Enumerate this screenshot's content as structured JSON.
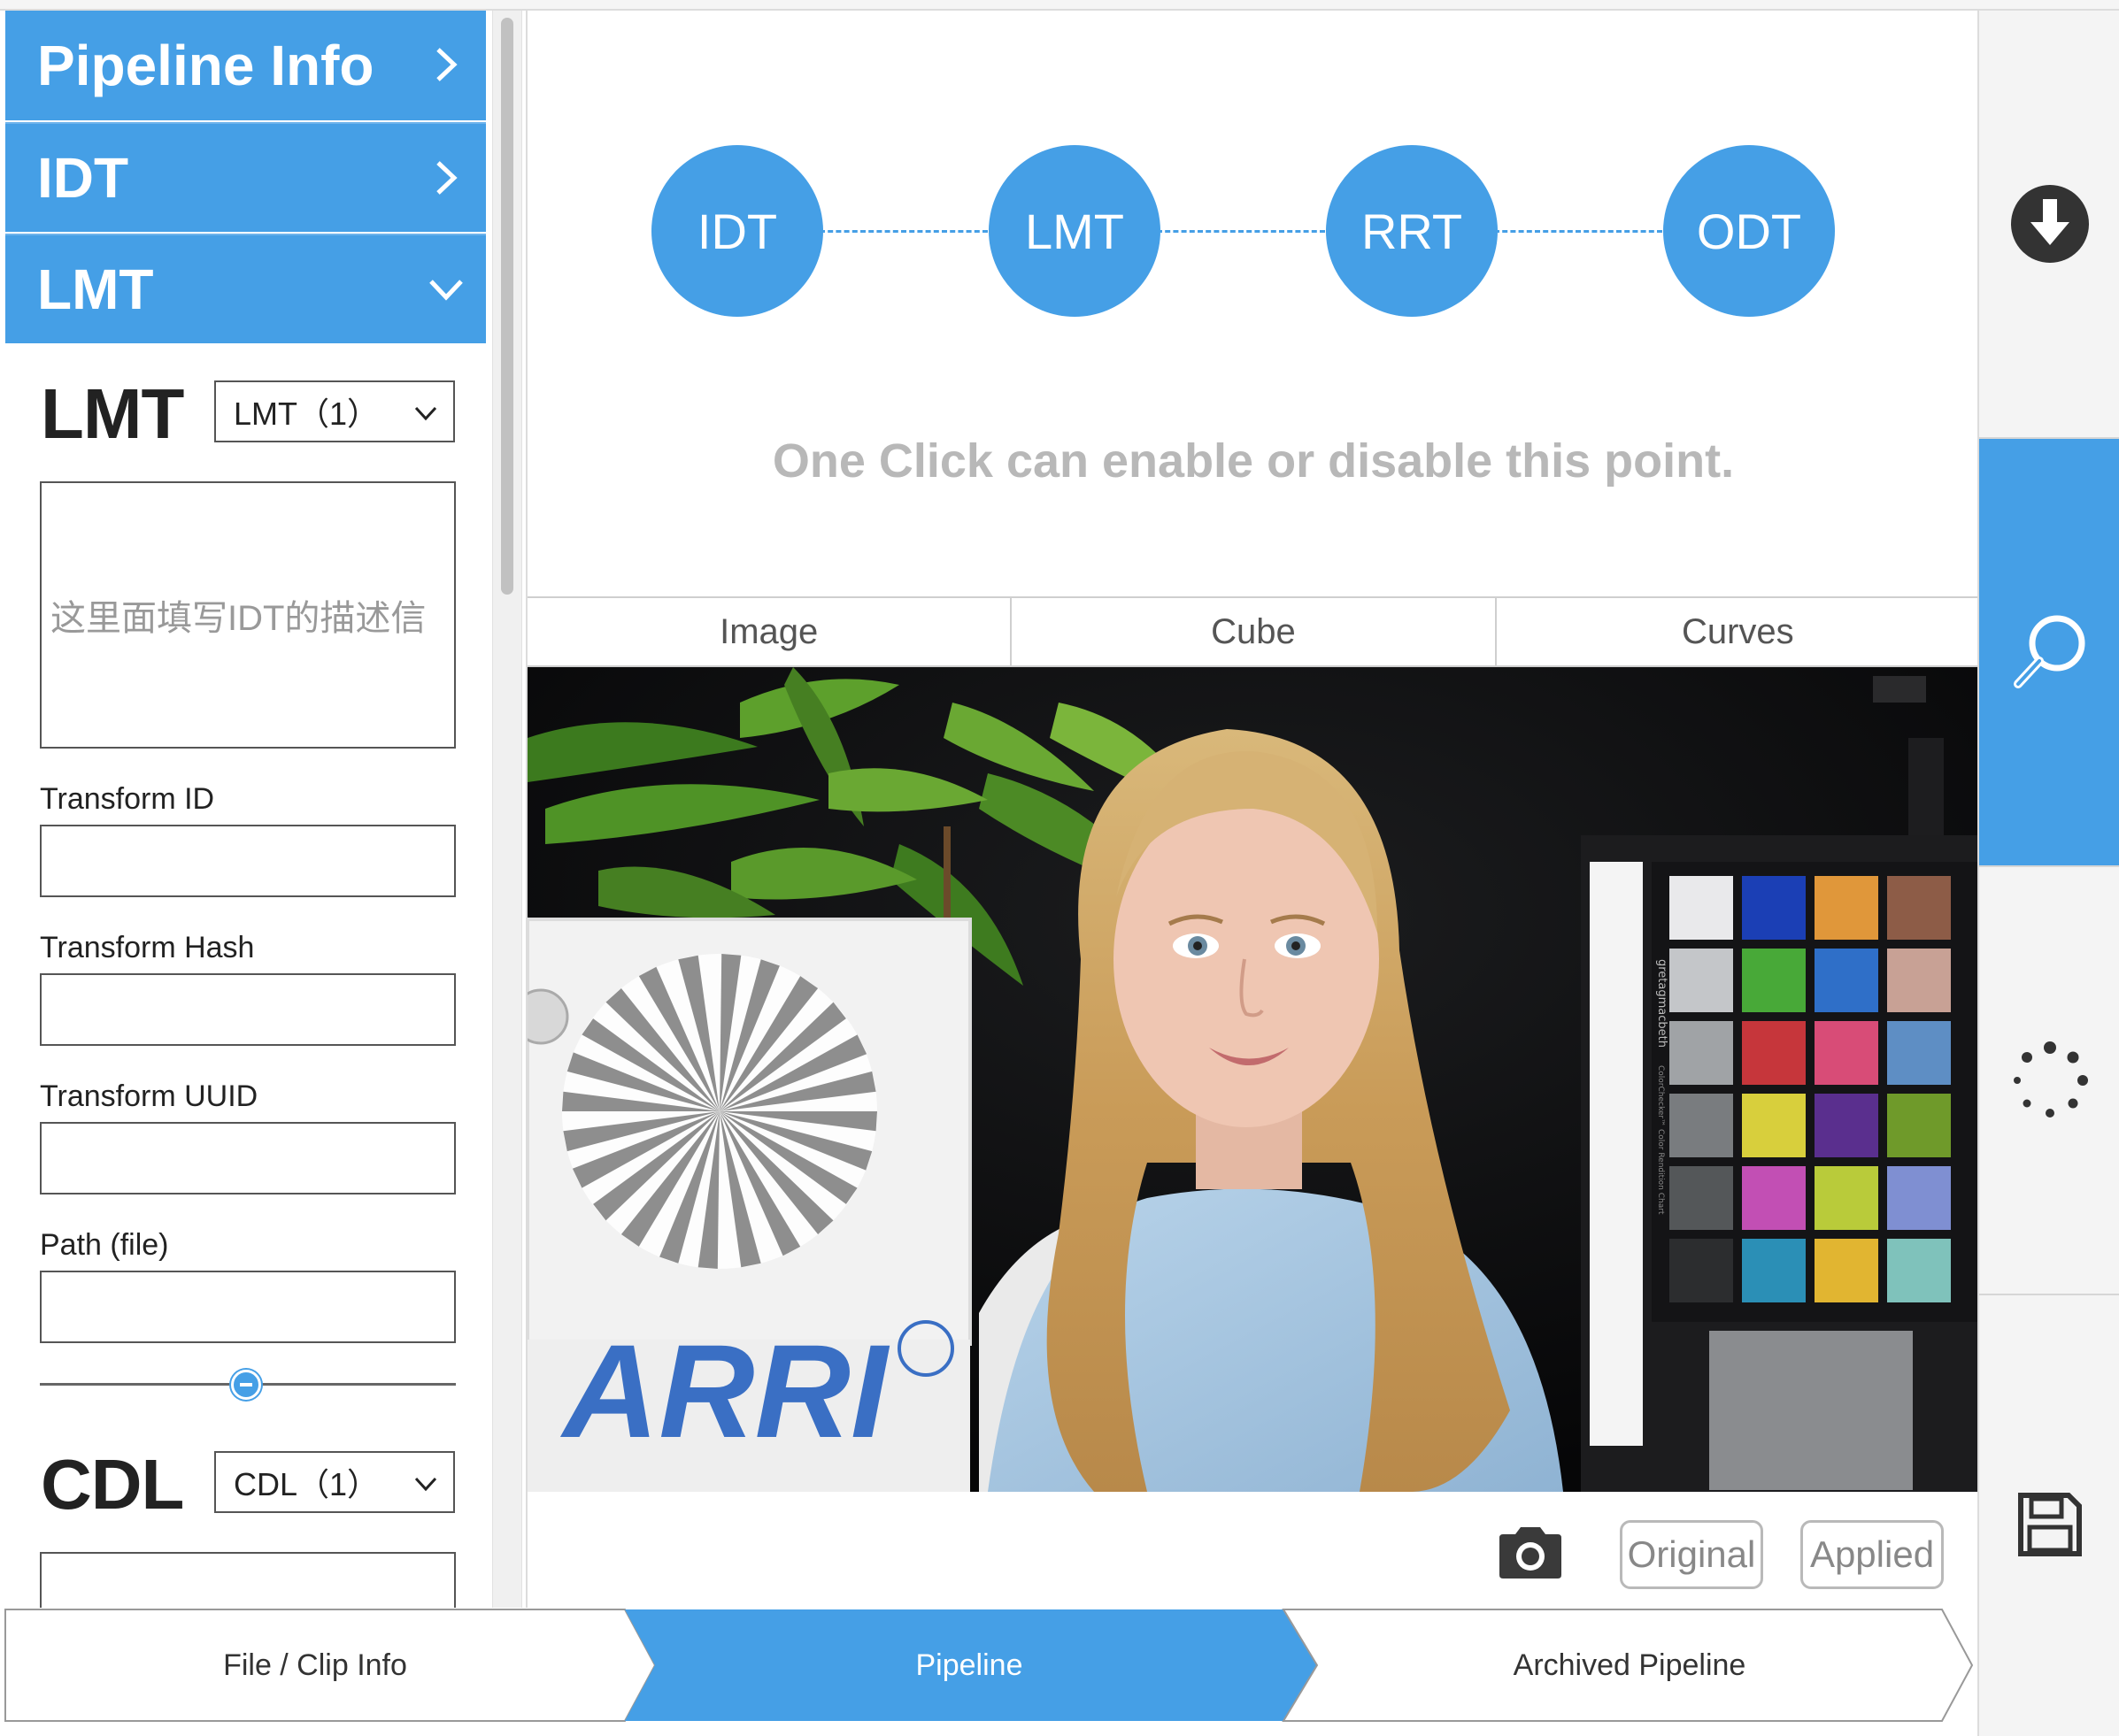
{
  "accordion": [
    {
      "label": "Pipeline Info",
      "state": "collapsed"
    },
    {
      "label": "IDT",
      "state": "collapsed"
    },
    {
      "label": "LMT",
      "state": "expanded"
    }
  ],
  "lmt_section": {
    "title": "LMT",
    "select_value": "LMT（1）",
    "description_placeholder": "这里面填写IDT的描述信",
    "fields": [
      {
        "label": "Transform ID",
        "value": ""
      },
      {
        "label": "Transform Hash",
        "value": ""
      },
      {
        "label": "Transform UUID",
        "value": ""
      },
      {
        "label": "Path (file)",
        "value": ""
      }
    ],
    "slider_value": 0.5
  },
  "cdl_section": {
    "title": "CDL",
    "select_value": "CDL（1）"
  },
  "pipeline_nodes": [
    "IDT",
    "LMT",
    "RRT",
    "ODT"
  ],
  "hint": "One Click can enable or disable this point.",
  "view_tabs": [
    "Image",
    "Cube",
    "Curves"
  ],
  "image": {
    "logo_text": "ARRI",
    "chart_brand": "gretagmacbeth",
    "chart_name": "ColorChecker™ Color Rendition Chart"
  },
  "image_actions": {
    "original": "Original",
    "applied": "Applied"
  },
  "right_toolbar": [
    {
      "icon": "download-icon",
      "active": false
    },
    {
      "icon": "search-icon",
      "active": true
    },
    {
      "icon": "loading-spinner-icon",
      "active": false
    },
    {
      "icon": "save-icon",
      "active": false
    }
  ],
  "steps": [
    {
      "label": "File / Clip Info",
      "active": false
    },
    {
      "label": "Pipeline",
      "active": true
    },
    {
      "label": "Archived Pipeline",
      "active": false
    }
  ],
  "colors": {
    "accent": "#459fe6",
    "hint_text": "#b8b8b8"
  }
}
